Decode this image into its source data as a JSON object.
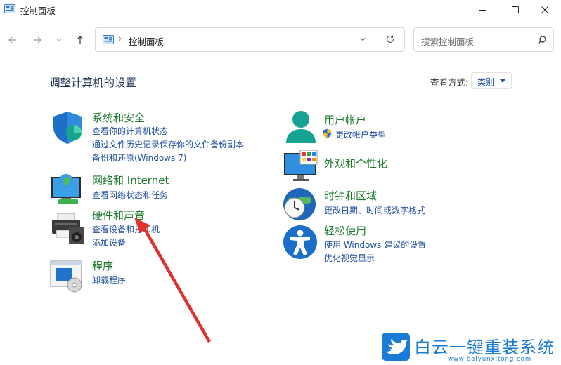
{
  "window": {
    "title": "控制面板"
  },
  "address_bar": {
    "location": "控制面板",
    "separator": "›"
  },
  "search": {
    "placeholder": "搜索控制面板"
  },
  "main": {
    "heading": "调整计算机的设置",
    "view_by_label": "查看方式:",
    "view_by_value": "类别"
  },
  "categories": {
    "system_security": {
      "title": "系统和安全",
      "links": [
        "查看你的计算机状态",
        "通过文件历史记录保存你的文件备份副本",
        "备份和还原(Windows 7)"
      ]
    },
    "network": {
      "title": "网络和 Internet",
      "links": [
        "查看网络状态和任务"
      ]
    },
    "hardware": {
      "title": "硬件和声音",
      "links": [
        "查看设备和打印机",
        "添加设备"
      ]
    },
    "programs": {
      "title": "程序",
      "links": [
        "卸载程序"
      ]
    },
    "user_accounts": {
      "title": "用户帐户",
      "links": [
        "更改帐户类型"
      ]
    },
    "appearance": {
      "title": "外观和个性化",
      "links": []
    },
    "clock_region": {
      "title": "时钟和区域",
      "links": [
        "更改日期、时间或数字格式"
      ]
    },
    "ease_of_access": {
      "title": "轻松使用",
      "links": [
        "使用 Windows 建议的设置",
        "优化视觉显示"
      ]
    }
  },
  "watermark": {
    "name": "白云一键重装系统",
    "url": "www.baiyunxitong.com"
  },
  "colors": {
    "title_green": "#1d7a2d",
    "link_blue": "#1f4f9e",
    "annotation_red": "#e0322b",
    "watermark_blue": "#1a7bd6"
  },
  "icons": [
    "control-panel-icon",
    "back-arrow-icon",
    "forward-arrow-icon",
    "history-dropdown-icon",
    "up-arrow-icon",
    "refresh-icon",
    "search-icon",
    "minimize-icon",
    "maximize-icon",
    "close-icon",
    "uac-shield-icon"
  ]
}
